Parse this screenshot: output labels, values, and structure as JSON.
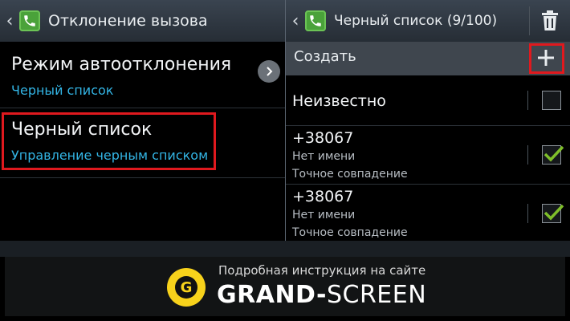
{
  "left_panel": {
    "title": "Отклонение вызова",
    "items": [
      {
        "title": "Режим автоотклонения",
        "subtitle": "Черный список"
      },
      {
        "title": "Черный список",
        "subtitle": "Управление черным списком"
      }
    ]
  },
  "right_panel": {
    "title": "Черный список (9/100)",
    "create_label": "Создать",
    "entries": [
      {
        "number": "Неизвестно",
        "checked": false
      },
      {
        "number": "+38067",
        "name": "Нет имени",
        "match": "Точное совпадение",
        "checked": true
      },
      {
        "number": "+38067",
        "name": "Нет имени",
        "match": "Точное совпадение",
        "checked": true
      }
    ]
  },
  "banner": {
    "caption": "Подробная инструкция на сайте",
    "brand_bold": "GRAND-",
    "brand_light": "SCREEN",
    "logo_letter": "G"
  },
  "colors": {
    "highlight": "#e0191e",
    "subtitle": "#33b5e5",
    "check": "#7fbf2a",
    "logo": "#f7d21b"
  }
}
